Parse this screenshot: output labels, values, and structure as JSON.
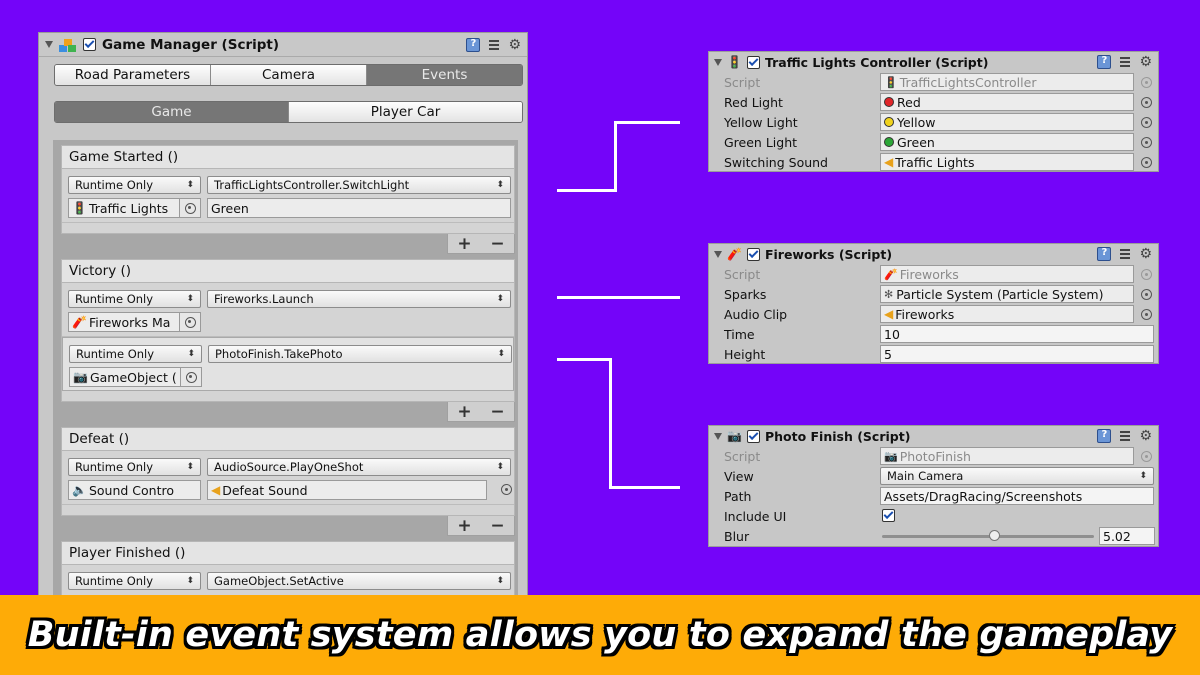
{
  "game_manager": {
    "title": "Game Manager (Script)",
    "tabs": [
      "Road Parameters",
      "Camera",
      "Events"
    ],
    "active_tab": "Events",
    "subtabs": [
      "Game",
      "Player Car"
    ],
    "active_subtab": "Game",
    "events": [
      {
        "title": "Game Started ()",
        "entries": [
          {
            "mode": "Runtime Only",
            "function": "TrafficLightsController.SwitchLight",
            "object": "Traffic Lights",
            "object_icon": "traffic-light-icon",
            "argument": "Green"
          }
        ]
      },
      {
        "title": "Victory ()",
        "entries": [
          {
            "mode": "Runtime Only",
            "function": "Fireworks.Launch",
            "object": "Fireworks Ma",
            "object_icon": "fireworks-icon",
            "argument": ""
          },
          {
            "mode": "Runtime Only",
            "function": "PhotoFinish.TakePhoto",
            "object": "GameObject (",
            "object_icon": "camera-icon",
            "argument": ""
          }
        ]
      },
      {
        "title": "Defeat ()",
        "entries": [
          {
            "mode": "Runtime Only",
            "function": "AudioSource.PlayOneShot",
            "object": "Sound Contro",
            "object_icon": "speaker-icon",
            "argument": "Defeat Sound"
          }
        ]
      },
      {
        "title": "Player Finished ()",
        "entries": [
          {
            "mode": "Runtime Only",
            "function": "GameObject.SetActive",
            "object": "",
            "argument": ""
          }
        ]
      }
    ],
    "add_label": "+",
    "remove_label": "−"
  },
  "traffic_lights": {
    "title": "Traffic Lights Controller (Script)",
    "rows": [
      {
        "label": "Script",
        "value": "TrafficLightsController",
        "disabled": true
      },
      {
        "label": "Red Light",
        "value": "Red",
        "dot_color": "#e0262a"
      },
      {
        "label": "Yellow Light",
        "value": "Yellow",
        "dot_color": "#f0d21b"
      },
      {
        "label": "Green Light",
        "value": "Green",
        "dot_color": "#2ca637"
      },
      {
        "label": "Switching Sound",
        "value": "Traffic Lights"
      }
    ]
  },
  "fireworks": {
    "title": "Fireworks (Script)",
    "rows": [
      {
        "label": "Script",
        "value": "Fireworks",
        "disabled": true
      },
      {
        "label": "Sparks",
        "value": "Particle System (Particle System)"
      },
      {
        "label": "Audio Clip",
        "value": "Fireworks"
      },
      {
        "label": "Time",
        "value": "10"
      },
      {
        "label": "Height",
        "value": "5"
      }
    ]
  },
  "photo_finish": {
    "title": "Photo Finish (Script)",
    "rows": [
      {
        "label": "Script",
        "value": "PhotoFinish",
        "disabled": true
      },
      {
        "label": "View",
        "value": "Main Camera"
      },
      {
        "label": "Path",
        "value": "Assets/DragRacing/Screenshots"
      },
      {
        "label": "Include UI",
        "value": ""
      },
      {
        "label": "Blur",
        "value": "5.02"
      }
    ],
    "include_ui": true,
    "blur_fraction": 0.53
  },
  "banner": {
    "text": "Built-in event system allows you to expand the gameplay"
  },
  "colors": {
    "background": "#7404f9",
    "banner": "#feab07",
    "panel": "#c8c8c8",
    "active_tab": "#767676"
  }
}
